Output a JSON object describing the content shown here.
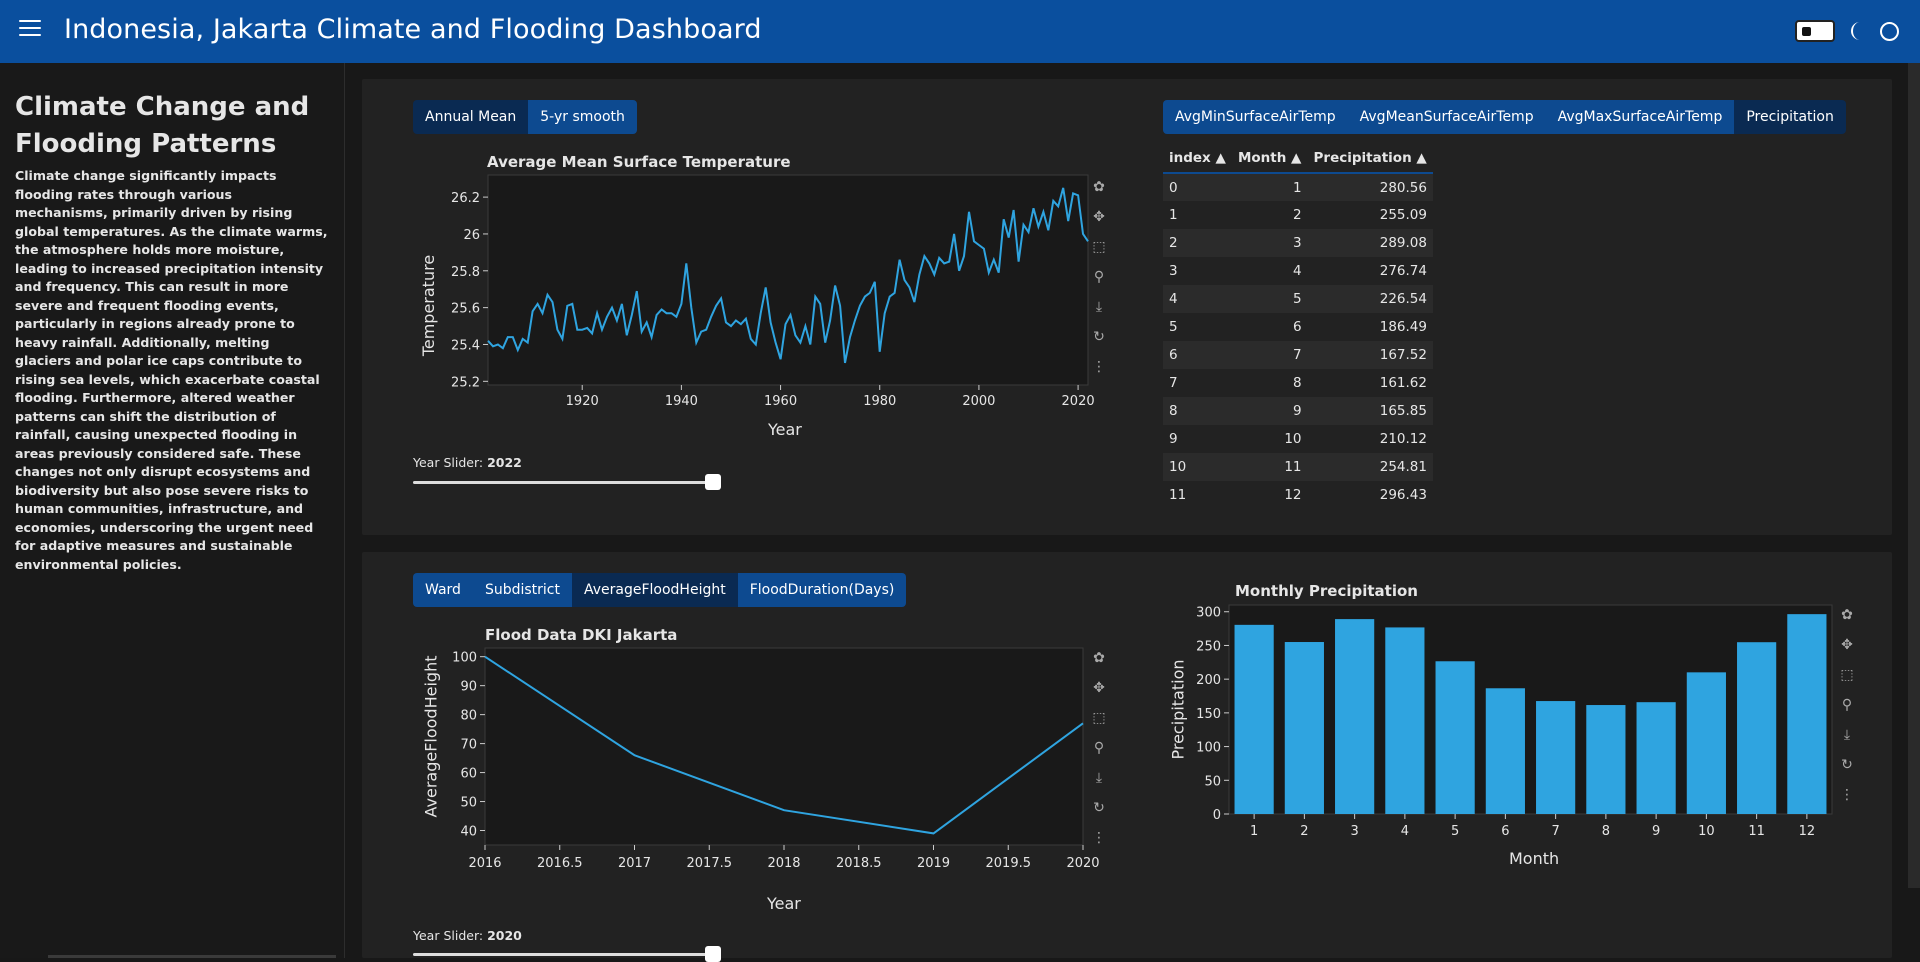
{
  "app": {
    "title": "Indonesia, Jakarta Climate and Flooding Dashboard"
  },
  "header": {
    "menu_icon": "hamburger-icon",
    "theme_icon": "moon-icon",
    "settings_icon": "circle-icon"
  },
  "sidebar": {
    "heading": "Climate Change and Flooding Patterns",
    "body": "Climate change significantly impacts flooding rates through various mechanisms, primarily driven by rising global temperatures. As the climate warms, the atmosphere holds more moisture, leading to increased precipitation intensity and frequency. This can result in more severe and frequent flooding events, particularly in regions already prone to heavy rainfall. Additionally, melting glaciers and polar ice caps contribute to rising sea levels, which exacerbate coastal flooding. Furthermore, altered weather patterns can shift the distribution of rainfall, causing unexpected flooding in areas previously considered safe. These changes not only disrupt ecosystems and biodiversity but also pose severe risks to human communities, infrastructure, and economies, underscoring the urgent need for adaptive measures and sustainable environmental policies."
  },
  "temp_panel": {
    "buttons": [
      "Annual Mean",
      "5-yr smooth"
    ],
    "slider_label": "Year Slider: ",
    "slider_value": "2022",
    "slider_fraction": 1.0
  },
  "table_panel": {
    "tabs": [
      "AvgMinSurfaceAirTemp",
      "AvgMeanSurfaceAirTemp",
      "AvgMaxSurfaceAirTemp",
      "Precipitation"
    ],
    "columns": [
      "index",
      "Month",
      "Precipitation"
    ],
    "rows": [
      [
        "0",
        "1",
        "280.56"
      ],
      [
        "1",
        "2",
        "255.09"
      ],
      [
        "2",
        "3",
        "289.08"
      ],
      [
        "3",
        "4",
        "276.74"
      ],
      [
        "4",
        "5",
        "226.54"
      ],
      [
        "5",
        "6",
        "186.49"
      ],
      [
        "6",
        "7",
        "167.52"
      ],
      [
        "7",
        "8",
        "161.62"
      ],
      [
        "8",
        "9",
        "165.85"
      ],
      [
        "9",
        "10",
        "210.12"
      ],
      [
        "10",
        "11",
        "254.81"
      ],
      [
        "11",
        "12",
        "296.43"
      ]
    ]
  },
  "flood_panel": {
    "buttons": [
      "Ward",
      "Subdistrict",
      "AverageFloodHeight",
      "FloodDuration(Days)"
    ],
    "slider_label": "Year Slider: ",
    "slider_value": "2020",
    "slider_fraction": 1.0
  },
  "colors": {
    "accent": "#0a4f9e",
    "series": "#2fa4e0",
    "plot_bg": "#191919"
  },
  "chart_data": [
    {
      "type": "line",
      "title": "Average Mean Surface Temperature",
      "xlabel": "Year",
      "ylabel": "Temperature",
      "xlim": [
        1901,
        2022
      ],
      "ylim": [
        25.18,
        26.32
      ],
      "xticks": [
        1920,
        1940,
        1960,
        1980,
        2000,
        2020
      ],
      "yticks": [
        25.2,
        25.4,
        25.6,
        25.8,
        26,
        26.2
      ],
      "ytick_labels": [
        "25.2",
        "25.4",
        "25.6",
        "25.8",
        "26",
        "26.2"
      ],
      "x_start": 1901,
      "values": [
        25.42,
        25.39,
        25.4,
        25.38,
        25.44,
        25.44,
        25.37,
        25.43,
        25.41,
        25.58,
        25.62,
        25.57,
        25.67,
        25.63,
        25.48,
        25.43,
        25.61,
        25.62,
        25.48,
        25.48,
        25.49,
        25.46,
        25.57,
        25.48,
        25.55,
        25.6,
        25.53,
        25.62,
        25.45,
        25.56,
        25.69,
        25.47,
        25.52,
        25.44,
        25.56,
        25.59,
        25.57,
        25.57,
        25.55,
        25.62,
        25.84,
        25.6,
        25.41,
        25.47,
        25.48,
        25.55,
        25.61,
        25.65,
        25.52,
        25.5,
        25.53,
        25.51,
        25.54,
        25.43,
        25.4,
        25.57,
        25.71,
        25.52,
        25.41,
        25.32,
        25.51,
        25.56,
        25.45,
        25.41,
        25.5,
        25.4,
        25.66,
        25.62,
        25.41,
        25.53,
        25.72,
        25.61,
        25.3,
        25.44,
        25.53,
        25.61,
        25.66,
        25.68,
        25.74,
        25.36,
        25.57,
        25.66,
        25.68,
        25.86,
        25.75,
        25.71,
        25.63,
        25.78,
        25.88,
        25.84,
        25.78,
        25.87,
        25.84,
        25.85,
        26.0,
        25.8,
        25.88,
        26.12,
        25.96,
        25.94,
        25.92,
        25.79,
        25.86,
        25.79,
        26.08,
        25.98,
        26.13,
        25.85,
        26.05,
        26.01,
        26.14,
        26.04,
        26.12,
        26.02,
        26.18,
        26.15,
        26.25,
        26.07,
        26.22,
        26.21,
        26.0,
        25.96
      ],
      "series_color": "#2fa4e0"
    },
    {
      "type": "line",
      "title": "Flood Data DKI Jakarta",
      "xlabel": "Year",
      "ylabel": "AverageFloodHeight",
      "x": [
        2016,
        2017,
        2018,
        2019,
        2020
      ],
      "values": [
        100,
        66,
        47,
        39,
        77
      ],
      "xlim": [
        2016,
        2020
      ],
      "ylim": [
        35,
        103
      ],
      "xticks": [
        2016,
        2016.5,
        2017,
        2017.5,
        2018,
        2018.5,
        2019,
        2019.5,
        2020
      ],
      "yticks": [
        40,
        50,
        60,
        70,
        80,
        90,
        100
      ],
      "series_color": "#2fa4e0"
    },
    {
      "type": "bar",
      "title": "Monthly Precipitation",
      "xlabel": "Month",
      "ylabel": "Precipitation",
      "categories": [
        "1",
        "2",
        "3",
        "4",
        "5",
        "6",
        "7",
        "8",
        "9",
        "10",
        "11",
        "12"
      ],
      "values": [
        280.56,
        255.09,
        289.08,
        276.74,
        226.54,
        186.49,
        167.52,
        161.62,
        165.85,
        210.12,
        254.81,
        296.43
      ],
      "ylim": [
        0,
        310
      ],
      "yticks": [
        0,
        50,
        100,
        150,
        200,
        250,
        300
      ],
      "series_color": "#2fa4e0"
    }
  ]
}
